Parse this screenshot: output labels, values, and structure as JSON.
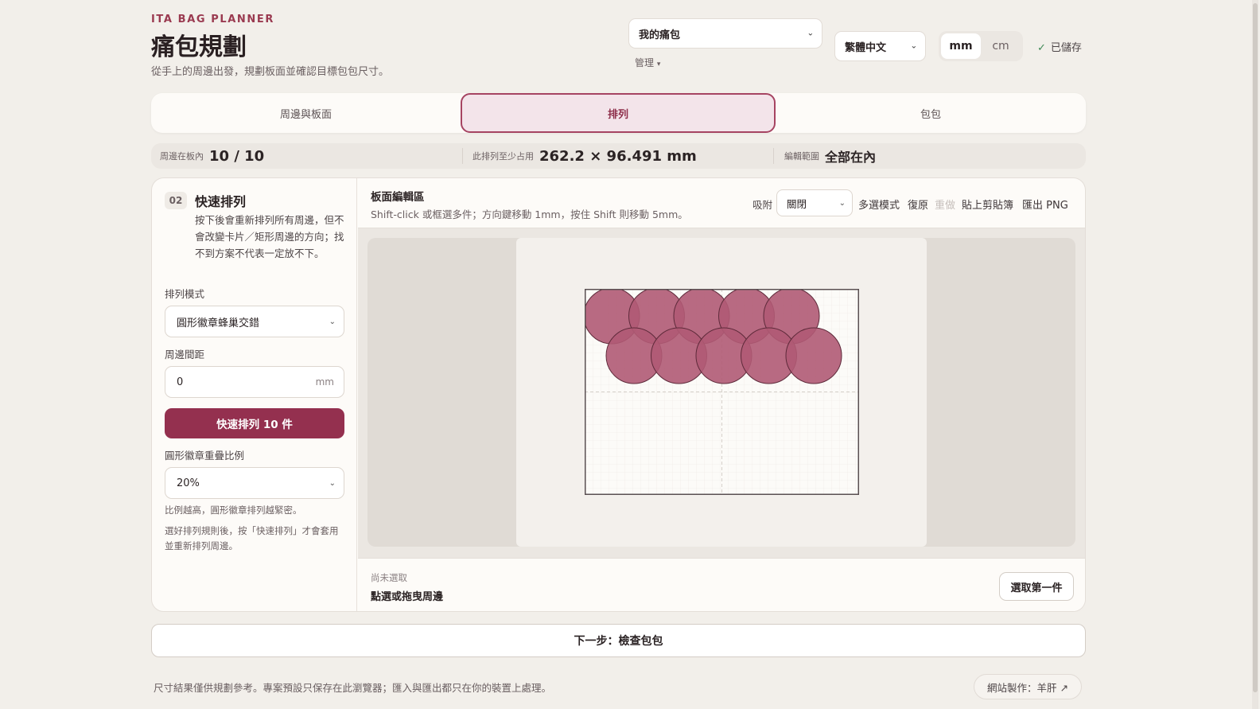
{
  "header": {
    "eyebrow": "ITA BAG PLANNER",
    "title": "痛包規劃",
    "subtitle": "從手上的周邊出發，規劃板面並確認目標包包尺寸。",
    "project_select": "我的痛包",
    "manage": "管理",
    "language_select": "繁體中文",
    "unit_mm": "mm",
    "unit_cm": "cm",
    "active_unit": "mm",
    "saved_check": "✓",
    "saved": "已儲存"
  },
  "tabs": [
    {
      "label": "周邊與板面",
      "active": false
    },
    {
      "label": "排列",
      "active": true
    },
    {
      "label": "包包",
      "active": false
    }
  ],
  "stats": {
    "in_board_label": "周邊在板內",
    "in_board_value": "10 / 10",
    "size_label": "此排列至少占用",
    "size_value": "262.2 × 96.491 mm",
    "range_label": "編輯範圍",
    "range_value": "全部在內"
  },
  "quick": {
    "step": "02",
    "title": "快速排列",
    "desc": "按下後會重新排列所有周邊，但不會改變卡片／矩形周邊的方向；找不到方案不代表一定放不下。",
    "mode_label": "排列模式",
    "mode_value": "圓形徽章蜂巢交錯",
    "gap_label": "周邊間距",
    "gap_value": "0",
    "gap_unit": "mm",
    "button": "快速排列 10 件",
    "overlap_label": "圓形徽章重疊比例",
    "overlap_value": "20%",
    "hint1": "比例越高，圓形徽章排列越緊密。",
    "hint2": "選好排列規則後，按「快速排列」才會套用並重新排列周邊。"
  },
  "editor": {
    "title": "板面編輯區",
    "subtitle": "Shift-click 或框選多件；方向鍵移動 1mm，按住 Shift 則移動 5mm。",
    "snap_label": "吸附",
    "snap_value": "關閉",
    "multi": "多選模式",
    "undo": "復原",
    "redo": "重做",
    "paste": "貼上剪貼簿",
    "export": "匯出 PNG",
    "selection_status": "尚未選取",
    "selection_hint": "點選或拖曳周邊",
    "select_first": "選取第一件",
    "badge_color": "#b05a74",
    "badge_count": 10
  },
  "next_step": "下一步：檢查包包",
  "footer": {
    "note": "尺寸結果僅供規劃參考。專案預設只保存在此瀏覽器；匯入與匯出都只在你的裝置上處理。",
    "credit": "網站製作：羊肝 ↗"
  }
}
